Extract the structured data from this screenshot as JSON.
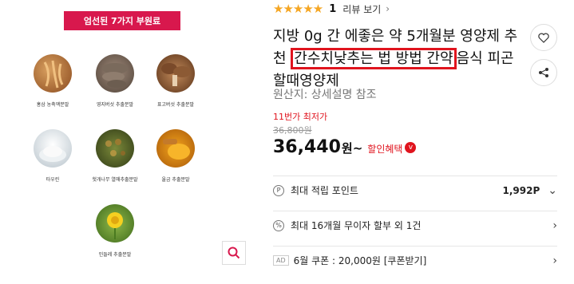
{
  "image_panel": {
    "banner": "엄선된 7가지 부원료",
    "ingredients": [
      {
        "label": "홍삼 농축액분말"
      },
      {
        "label": "영지버섯 추출분말"
      },
      {
        "label": "표고버섯 추출분말"
      },
      {
        "label": "타우린"
      },
      {
        "label": "헛개나무 열매추출분말"
      },
      {
        "label": "울금 추출분말"
      },
      {
        "label": "민들레 추출분말"
      }
    ],
    "zoom_icon": "search-icon"
  },
  "product": {
    "rating_stars": "★★★★★",
    "rating": "1",
    "review_link": "리뷰 보기",
    "title_part1": "지방 0g 간 에좋은 약 5개월분 영양제 추천",
    "title_highlight": "간수치낮추는 법 방법 간약",
    "title_part2": "음식 피곤할때영양제",
    "origin": "원산지: 상세설명 참조",
    "lowest_label": "11번가 최저가",
    "original_price": "36,800원",
    "price": "36,440",
    "price_unit": "원~",
    "discount_label": "할인혜택",
    "discount_badge": "v"
  },
  "rows": [
    {
      "lead": "P",
      "text": "최대 적립 포인트",
      "value": "1,992P",
      "chevron": "⌄"
    },
    {
      "lead": "%",
      "text": "최대 16개월 무이자 할부 외 1건",
      "value": "",
      "chevron": "›"
    },
    {
      "lead": "AD",
      "text": "6월 쿠폰 : 20,000원 [쿠폰받기]",
      "value": "",
      "chevron": "›"
    }
  ],
  "icons": {
    "like": "heart-icon",
    "share": "share-icon"
  },
  "colors": {
    "banner": "#d8184d",
    "accent": "#e0141e",
    "star": "#f5a623"
  }
}
